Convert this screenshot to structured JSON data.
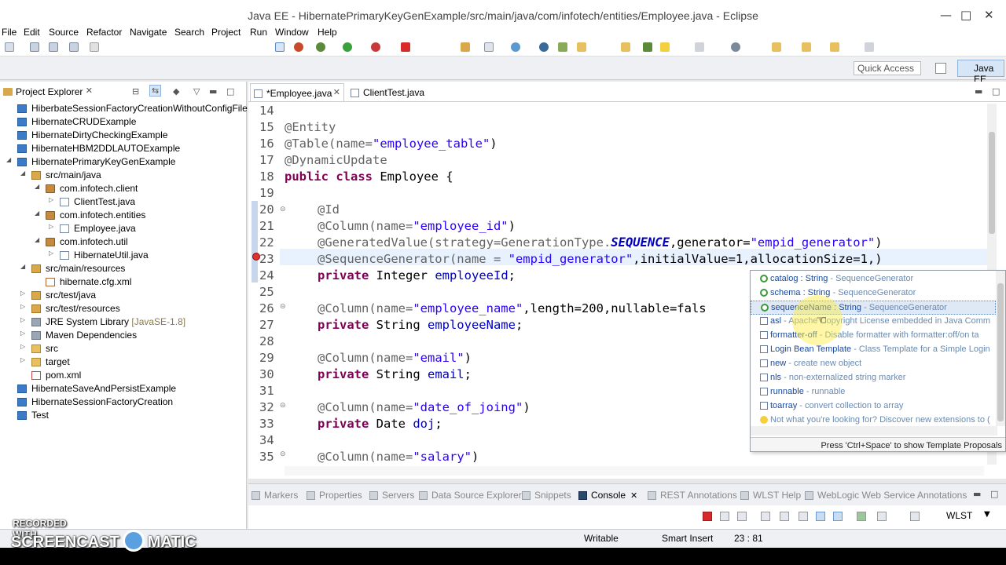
{
  "window": {
    "title": "Java EE - HibernatePrimaryKeyGenExample/src/main/java/com/infotech/entities/Employee.java - Eclipse"
  },
  "menu": [
    "File",
    "Edit",
    "Source",
    "Refactor",
    "Navigate",
    "Search",
    "Project",
    "Run",
    "Window",
    "Help"
  ],
  "perspective": {
    "quick_access": "Quick Access",
    "current": "Java EE"
  },
  "explorer": {
    "title": "Project Explorer",
    "items": [
      {
        "label": "HiberbateSessionFactoryCreationWithoutConfigFile"
      },
      {
        "label": "HibernateCRUDExample"
      },
      {
        "label": "HibernateDirtyCheckingExample"
      },
      {
        "label": "HibernateHBM2DDLAUTOExample"
      },
      {
        "label": "HibernatePrimaryKeyGenExample"
      },
      {
        "label": "src/main/java"
      },
      {
        "label": "com.infotech.client"
      },
      {
        "label": "ClientTest.java"
      },
      {
        "label": "com.infotech.entities"
      },
      {
        "label": "Employee.java"
      },
      {
        "label": "com.infotech.util"
      },
      {
        "label": "HibernateUtil.java"
      },
      {
        "label": "src/main/resources"
      },
      {
        "label": "hibernate.cfg.xml"
      },
      {
        "label": "src/test/java"
      },
      {
        "label": "src/test/resources"
      },
      {
        "label": "JRE System Library",
        "suffix": "[JavaSE-1.8]"
      },
      {
        "label": "Maven Dependencies"
      },
      {
        "label": "src"
      },
      {
        "label": "target"
      },
      {
        "label": "pom.xml"
      },
      {
        "label": "HibernateSaveAndPersistExample"
      },
      {
        "label": "HibernateSessionFactoryCreation"
      },
      {
        "label": "Test"
      }
    ]
  },
  "editor": {
    "tabs": [
      {
        "label": "*Employee.java"
      },
      {
        "label": "ClientTest.java"
      }
    ],
    "line_numbers": [
      "14",
      "15",
      "16",
      "17",
      "18",
      "19",
      "20",
      "21",
      "22",
      "23",
      "24",
      "25",
      "26",
      "27",
      "28",
      "29",
      "30",
      "31",
      "32",
      "33",
      "34",
      "35"
    ],
    "code": {
      "l15": "@Entity",
      "l16a": "@Table(name=",
      "l16b": "\"employee_table\"",
      "l16c": ")",
      "l17": "@DynamicUpdate",
      "l18a": "public class",
      "l18b": " Employee {",
      "l20": "@Id",
      "l21a": "@Column(name=",
      "l21b": "\"employee_id\"",
      "l21c": ")",
      "l22a": "@GeneratedValue(strategy=GenerationType.",
      "l22b": "SEQUENCE",
      "l22c": ",generator=",
      "l22d": "\"empid_generator\"",
      "l22e": ")",
      "l23a": "@SequenceGenerator(name = ",
      "l23b": "\"empid_generator\"",
      "l23c": ",initialValue=1,allocationSize=1,)",
      "l24a": "private",
      "l24b": " Integer ",
      "l24c": "employeeId",
      "l24d": ";",
      "l26a": "@Column(name=",
      "l26b": "\"employee_name\"",
      "l26c": ",length=200,nullable=fals",
      "l27a": "private",
      "l27b": " String ",
      "l27c": "employeeName",
      "l27d": ";",
      "l29a": "@Column(name=",
      "l29b": "\"email\"",
      "l29c": ")",
      "l30a": "private",
      "l30b": " String ",
      "l30c": "email",
      "l30d": ";",
      "l32a": "@Column(name=",
      "l32b": "\"date_of_joing\"",
      "l32c": ")",
      "l33a": "private",
      "l33b": " Date ",
      "l33c": "doj",
      "l33d": ";",
      "l35a": "@Column(name=",
      "l35b": "\"salary\"",
      "l35c": ")"
    }
  },
  "content_assist": {
    "proposals": [
      {
        "name": "catalog : String",
        "rest": " - SequenceGenerator"
      },
      {
        "name": "schema : String",
        "rest": " - SequenceGenerator"
      },
      {
        "name": "sequenceName : String",
        "rest": " - SequenceGenerator"
      },
      {
        "name": "asl",
        "rest": " - Apache Copyright License embedded in Java Comm"
      },
      {
        "name": "formatter-off",
        "rest": " - Disable formatter with formatter:off/on ta"
      },
      {
        "name": "Login Bean Template",
        "rest": " - Class Template for a Simple Login"
      },
      {
        "name": "new",
        "rest": " - create new object"
      },
      {
        "name": "nls",
        "rest": " - non-externalized string marker"
      },
      {
        "name": "runnable",
        "rest": " - runnable"
      },
      {
        "name": "toarray",
        "rest": " - convert collection to array"
      },
      {
        "name": "Not what you're looking for? Discover new extensions to (",
        "rest": ""
      }
    ],
    "footer": "Press 'Ctrl+Space' to show Template Proposals"
  },
  "bottom_tabs": [
    {
      "label": "Markers"
    },
    {
      "label": "Properties"
    },
    {
      "label": "Servers"
    },
    {
      "label": "Data Source Explorer"
    },
    {
      "label": "Snippets"
    },
    {
      "label": "Console"
    },
    {
      "label": "REST Annotations"
    },
    {
      "label": "WLST Help"
    },
    {
      "label": "WebLogic Web Service Annotations"
    }
  ],
  "console_toolbar": {
    "wlst": "WLST"
  },
  "status": {
    "writable": "Writable",
    "insert_mode": "Smart Insert",
    "position": "23 : 81"
  },
  "watermark": {
    "top": "RECORDED WITH",
    "left": "SCREENCAST",
    "right": "MATIC"
  }
}
